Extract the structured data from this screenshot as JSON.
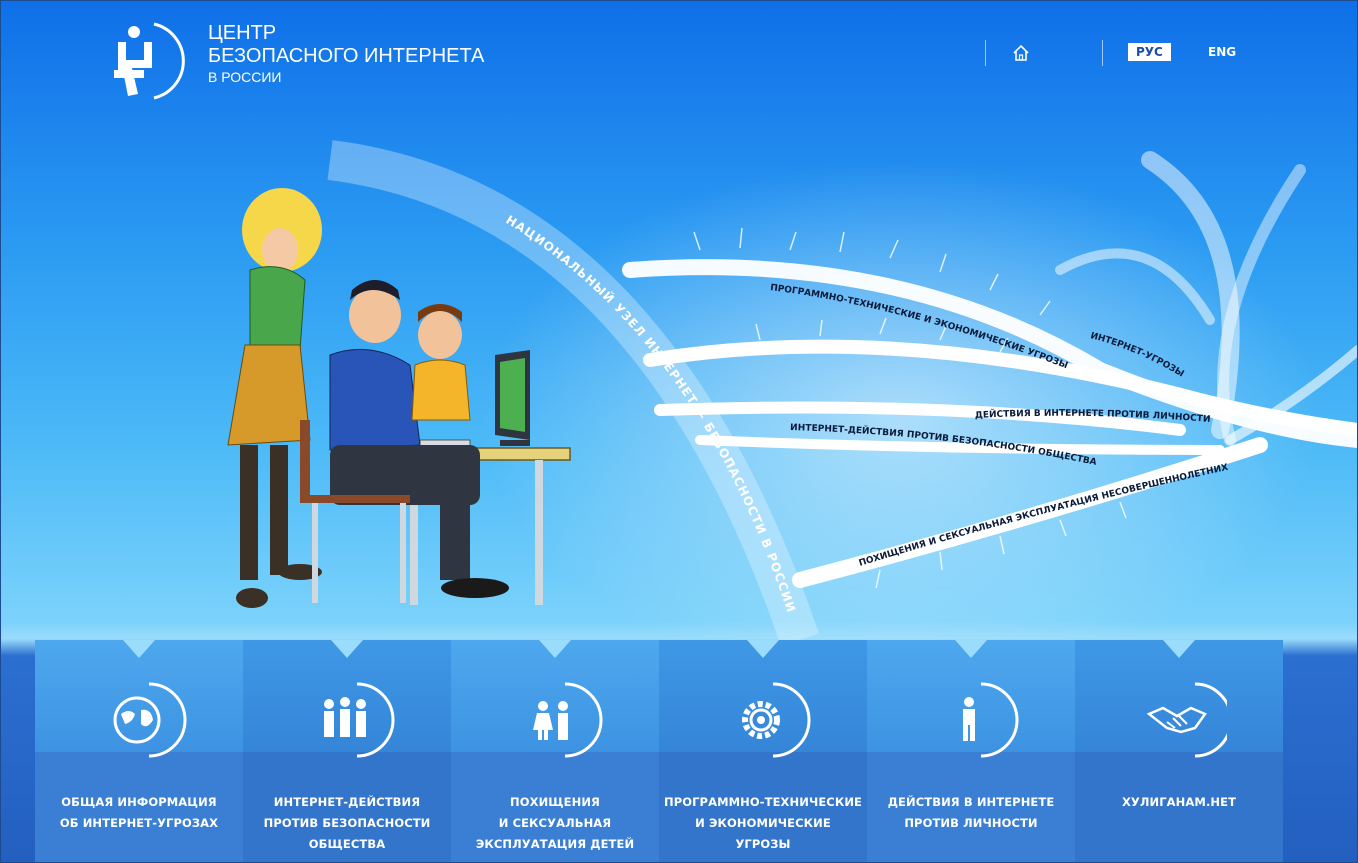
{
  "header": {
    "brand_line1": "ЦЕНТР",
    "brand_line2": "БЕЗОПАСНОГО ИНТЕРНЕТА",
    "brand_line3": "В РОССИИ",
    "home_icon": "home-icon",
    "lang_ru": "РУС",
    "lang_en": "ENG",
    "logo_icon": "safe-internet-center-logo"
  },
  "hero": {
    "arc_text": "НАЦИОНАЛЬНЫЙ УЗЕЛ ИНТЕРНЕТ — БЕЗОПАСНОСТИ В РОССИИ",
    "strand_labels": [
      "ПРОГРАММНО-ТЕХНИЧЕСКИЕ И ЭКОНОМИЧЕСКИЕ УГРОЗЫ",
      "ИНТЕРНЕТ-УГРОЗЫ",
      "ДЕЙСТВИЯ В ИНТЕРНЕТЕ ПРОТИВ ЛИЧНОСТИ",
      "ИНТЕРНЕТ-ДЕЙСТВИЯ ПРОТИВ БЕЗОПАСНОСТИ ОБЩЕСТВА",
      "ПОХИЩЕНИЯ И СЕКСУАЛЬНАЯ ЭКСПЛУАТАЦИЯ НЕСОВЕРШЕННОЛЕТНИХ"
    ]
  },
  "nav": [
    {
      "label": "ОБЩАЯ ИНФОРМАЦИЯ\nОБ ИНТЕРНЕТ-УГРОЗАХ",
      "icon": "globe-icon"
    },
    {
      "label": "ИНТЕРНЕТ-ДЕЙСТВИЯ\nПРОТИВ БЕЗОПАСНОСТИ\nОБЩЕСТВА",
      "icon": "people-group-icon"
    },
    {
      "label": "ПОХИЩЕНИЯ\nИ СЕКСУАЛЬНАЯ\nЭКСПЛУАТАЦИЯ ДЕТЕЙ",
      "icon": "children-icon"
    },
    {
      "label": "ПРОГРАММНО-ТЕХНИЧЕСКИЕ\nИ ЭКОНОМИЧЕСКИЕ\nУГРОЗЫ",
      "icon": "gear-icon"
    },
    {
      "label": "ДЕЙСТВИЯ В ИНТЕРНЕТЕ\nПРОТИВ ЛИЧНОСТИ",
      "icon": "person-icon"
    },
    {
      "label": "ХУЛИГАНАМ.НЕТ",
      "icon": "handshake-icon"
    }
  ]
}
